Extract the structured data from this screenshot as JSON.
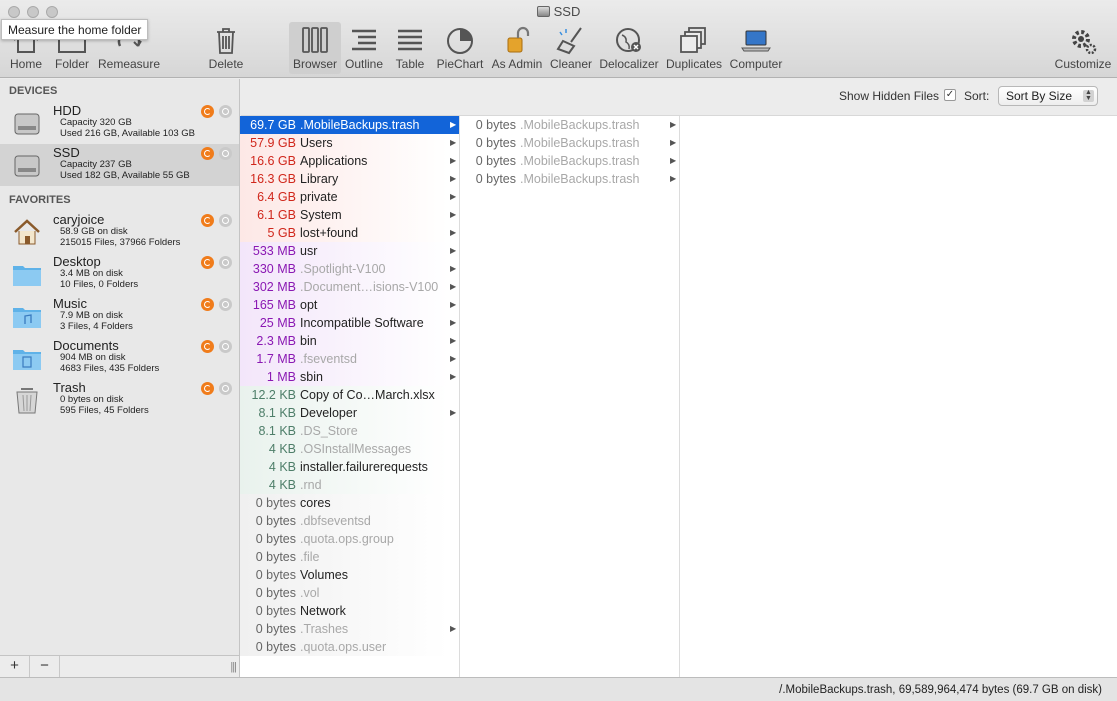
{
  "window": {
    "title": "SSD",
    "tooltip": "Measure the home folder"
  },
  "toolbar": {
    "home": "Home",
    "folder": "Folder",
    "remeasure": "Remeasure",
    "delete": "Delete",
    "browser": "Browser",
    "outline": "Outline",
    "table": "Table",
    "piechart": "PieChart",
    "as_admin": "As Admin",
    "cleaner": "Cleaner",
    "delocalizer": "Delocalizer",
    "duplicates": "Duplicates",
    "computer": "Computer",
    "customize": "Customize"
  },
  "sidebar": {
    "devices_label": "DEVICES",
    "favorites_label": "FAVORITES",
    "devices": [
      {
        "name": "HDD",
        "line1": "Capacity 320 GB",
        "line2": "Used 216 GB, Available 103 GB",
        "icon": "hard-drive-icon"
      },
      {
        "name": "SSD",
        "line1": "Capacity 237 GB",
        "line2": "Used 182 GB, Available 55 GB",
        "icon": "hard-drive-icon"
      }
    ],
    "favorites": [
      {
        "name": "caryjoice",
        "line1": "58.9 GB on disk",
        "line2": "215015 Files, 37966 Folders",
        "icon": "home-folder-icon"
      },
      {
        "name": "Desktop",
        "line1": "3.4 MB on disk",
        "line2": "10 Files, 0 Folders",
        "icon": "folder-icon"
      },
      {
        "name": "Music",
        "line1": "7.9 MB on disk",
        "line2": "3 Files, 4 Folders",
        "icon": "music-folder-icon"
      },
      {
        "name": "Documents",
        "line1": "904 MB on disk",
        "line2": "4683 Files, 435 Folders",
        "icon": "documents-folder-icon"
      },
      {
        "name": "Trash",
        "line1": "0 bytes on disk",
        "line2": "595 Files, 45 Folders",
        "icon": "trash-icon"
      }
    ],
    "add": "+",
    "remove": "−",
    "grip": "|||"
  },
  "header": {
    "show_hidden_label": "Show Hidden Files",
    "show_hidden_checked": "✓",
    "sort_label": "Sort:",
    "sort_value": "Sort By Size"
  },
  "colors": {
    "gb": "#d0261b",
    "mb": "#8a18b3",
    "kb": "#4e7e69",
    "bytes": "#666666",
    "selection": "#1264d9"
  },
  "column1": [
    {
      "size": "69.7 GB",
      "name": ".MobileBackups.trash",
      "hidden": true,
      "folder": true,
      "unit": "gb",
      "selected": true
    },
    {
      "size": "57.9 GB",
      "name": "Users",
      "hidden": false,
      "folder": true,
      "unit": "gb"
    },
    {
      "size": "16.6 GB",
      "name": "Applications",
      "hidden": false,
      "folder": true,
      "unit": "gb"
    },
    {
      "size": "16.3 GB",
      "name": "Library",
      "hidden": false,
      "folder": true,
      "unit": "gb"
    },
    {
      "size": "6.4 GB",
      "name": "private",
      "hidden": false,
      "folder": true,
      "unit": "gb"
    },
    {
      "size": "6.1 GB",
      "name": "System",
      "hidden": false,
      "folder": true,
      "unit": "gb"
    },
    {
      "size": "5 GB",
      "name": "lost+found",
      "hidden": false,
      "folder": true,
      "unit": "gb"
    },
    {
      "size": "533 MB",
      "name": "usr",
      "hidden": false,
      "folder": true,
      "unit": "mb"
    },
    {
      "size": "330 MB",
      "name": ".Spotlight-V100",
      "hidden": true,
      "folder": true,
      "unit": "mb"
    },
    {
      "size": "302 MB",
      "name": ".Document…isions-V100",
      "hidden": true,
      "folder": true,
      "unit": "mb"
    },
    {
      "size": "165 MB",
      "name": "opt",
      "hidden": false,
      "folder": true,
      "unit": "mb"
    },
    {
      "size": "25 MB",
      "name": "Incompatible Software",
      "hidden": false,
      "folder": true,
      "unit": "mb"
    },
    {
      "size": "2.3 MB",
      "name": "bin",
      "hidden": false,
      "folder": true,
      "unit": "mb"
    },
    {
      "size": "1.7 MB",
      "name": ".fseventsd",
      "hidden": true,
      "folder": true,
      "unit": "mb"
    },
    {
      "size": "1 MB",
      "name": "sbin",
      "hidden": false,
      "folder": true,
      "unit": "mb"
    },
    {
      "size": "12.2 KB",
      "name": "Copy of Co…March.xlsx",
      "hidden": false,
      "folder": false,
      "unit": "kb"
    },
    {
      "size": "8.1 KB",
      "name": "Developer",
      "hidden": false,
      "folder": true,
      "unit": "kb"
    },
    {
      "size": "8.1 KB",
      "name": ".DS_Store",
      "hidden": true,
      "folder": false,
      "unit": "kb"
    },
    {
      "size": "4 KB",
      "name": ".OSInstallMessages",
      "hidden": true,
      "folder": false,
      "unit": "kb"
    },
    {
      "size": "4 KB",
      "name": "installer.failurerequests",
      "hidden": false,
      "folder": false,
      "unit": "kb"
    },
    {
      "size": "4 KB",
      "name": ".rnd",
      "hidden": true,
      "folder": false,
      "unit": "kb"
    },
    {
      "size": "0 bytes",
      "name": "cores",
      "hidden": false,
      "folder": false,
      "unit": "bytes"
    },
    {
      "size": "0 bytes",
      "name": ".dbfseventsd",
      "hidden": true,
      "folder": false,
      "unit": "bytes"
    },
    {
      "size": "0 bytes",
      "name": ".quota.ops.group",
      "hidden": true,
      "folder": false,
      "unit": "bytes"
    },
    {
      "size": "0 bytes",
      "name": ".file",
      "hidden": true,
      "folder": false,
      "unit": "bytes"
    },
    {
      "size": "0 bytes",
      "name": "Volumes",
      "hidden": false,
      "folder": false,
      "unit": "bytes"
    },
    {
      "size": "0 bytes",
      "name": ".vol",
      "hidden": true,
      "folder": false,
      "unit": "bytes"
    },
    {
      "size": "0 bytes",
      "name": "Network",
      "hidden": false,
      "folder": false,
      "unit": "bytes"
    },
    {
      "size": "0 bytes",
      "name": ".Trashes",
      "hidden": true,
      "folder": true,
      "unit": "bytes"
    },
    {
      "size": "0 bytes",
      "name": ".quota.ops.user",
      "hidden": true,
      "folder": false,
      "unit": "bytes"
    }
  ],
  "column2": [
    {
      "size": "0 bytes",
      "name": ".MobileBackups.trash",
      "hidden": true,
      "folder": true
    },
    {
      "size": "0 bytes",
      "name": ".MobileBackups.trash",
      "hidden": true,
      "folder": true
    },
    {
      "size": "0 bytes",
      "name": ".MobileBackups.trash",
      "hidden": true,
      "folder": true
    },
    {
      "size": "0 bytes",
      "name": ".MobileBackups.trash",
      "hidden": true,
      "folder": true
    }
  ],
  "status": "/.MobileBackups.trash, 69,589,964,474 bytes (69.7 GB on disk)"
}
